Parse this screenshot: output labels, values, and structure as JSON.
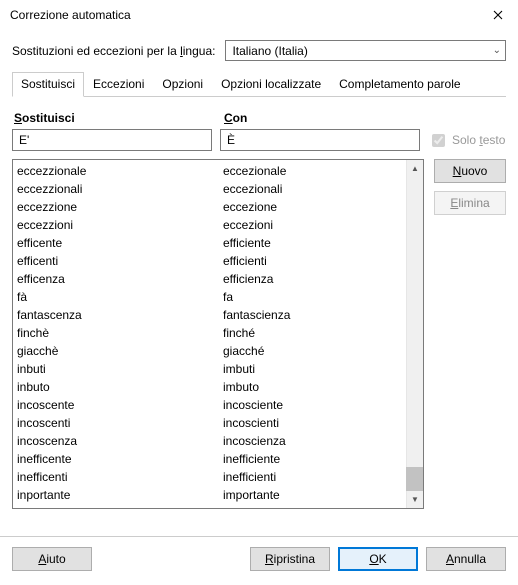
{
  "window": {
    "title": "Correzione automatica"
  },
  "lang_row": {
    "label_prefix": "Sostituzioni ed eccezioni per la ",
    "label_u": "l",
    "label_suffix": "ingua:",
    "value": "Italiano (Italia)"
  },
  "tabs": [
    {
      "label": "Sostituisci",
      "active": true
    },
    {
      "label": "Eccezioni",
      "active": false
    },
    {
      "label": "Opzioni",
      "active": false
    },
    {
      "label": "Opzioni localizzate",
      "active": false
    },
    {
      "label": "Completamento parole",
      "active": false
    }
  ],
  "columns": {
    "replace_u": "S",
    "replace_rest": "ostituisci",
    "with_u": "C",
    "with_rest": "on"
  },
  "inputs": {
    "replace_value": "E'",
    "with_value": "È"
  },
  "solo_testo": {
    "prefix": "Solo ",
    "u": "t",
    "suffix": "esto",
    "checked": true,
    "disabled": true
  },
  "side_buttons": {
    "new_u": "N",
    "new_rest": "uovo",
    "delete_u": "E",
    "delete_rest": "limina",
    "delete_disabled": true
  },
  "list": [
    {
      "a": "eccezzionale",
      "b": "eccezionale"
    },
    {
      "a": "eccezzionali",
      "b": "eccezionali"
    },
    {
      "a": "eccezzione",
      "b": "eccezione"
    },
    {
      "a": "eccezzioni",
      "b": "eccezioni"
    },
    {
      "a": "efficente",
      "b": "efficiente"
    },
    {
      "a": "efficenti",
      "b": "efficienti"
    },
    {
      "a": "efficenza",
      "b": "efficienza"
    },
    {
      "a": "fà",
      "b": "fa"
    },
    {
      "a": "fantascenza",
      "b": "fantascienza"
    },
    {
      "a": "finchè",
      "b": "finché"
    },
    {
      "a": "giacchè",
      "b": "giacché"
    },
    {
      "a": "inbuti",
      "b": "imbuti"
    },
    {
      "a": "inbuto",
      "b": "imbuto"
    },
    {
      "a": "incoscente",
      "b": "incosciente"
    },
    {
      "a": "incoscenti",
      "b": "incoscienti"
    },
    {
      "a": "incoscenza",
      "b": "incoscienza"
    },
    {
      "a": "inefficente",
      "b": "inefficiente"
    },
    {
      "a": "inefficenti",
      "b": "inefficienti"
    },
    {
      "a": "inportante",
      "b": "importante"
    }
  ],
  "footer": {
    "help_u": "A",
    "help_rest": "iuto",
    "reset_u": "R",
    "reset_rest": "ipristina",
    "ok_u": "O",
    "ok_rest": "K",
    "cancel_u": "A",
    "cancel_rest": "nnulla"
  }
}
